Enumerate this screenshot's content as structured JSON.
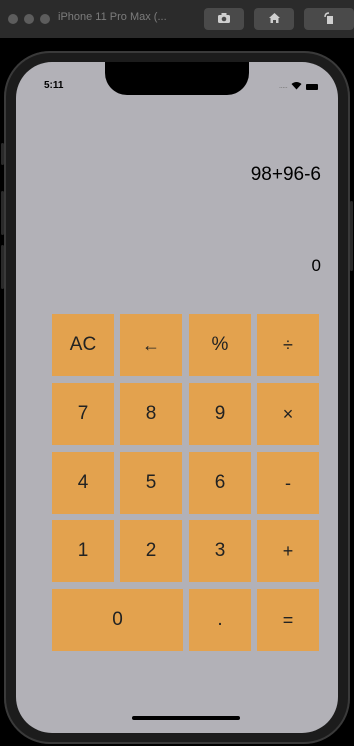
{
  "simulator": {
    "title": "iPhone 11 Pro Max (..."
  },
  "status": {
    "time": "5:11"
  },
  "display": {
    "expression": "98+96-6",
    "result": "0"
  },
  "keys": {
    "ac": "AC",
    "back": "←",
    "percent": "%",
    "divide": "÷",
    "seven": "7",
    "eight": "8",
    "nine": "9",
    "multiply": "×",
    "four": "4",
    "five": "5",
    "six": "6",
    "minus": "-",
    "one": "1",
    "two": "2",
    "three": "3",
    "plus": "+",
    "zero": "0",
    "dot": ".",
    "equals": "="
  },
  "colors": {
    "key": "#e3a24e",
    "screen": "#b2b1b7"
  }
}
